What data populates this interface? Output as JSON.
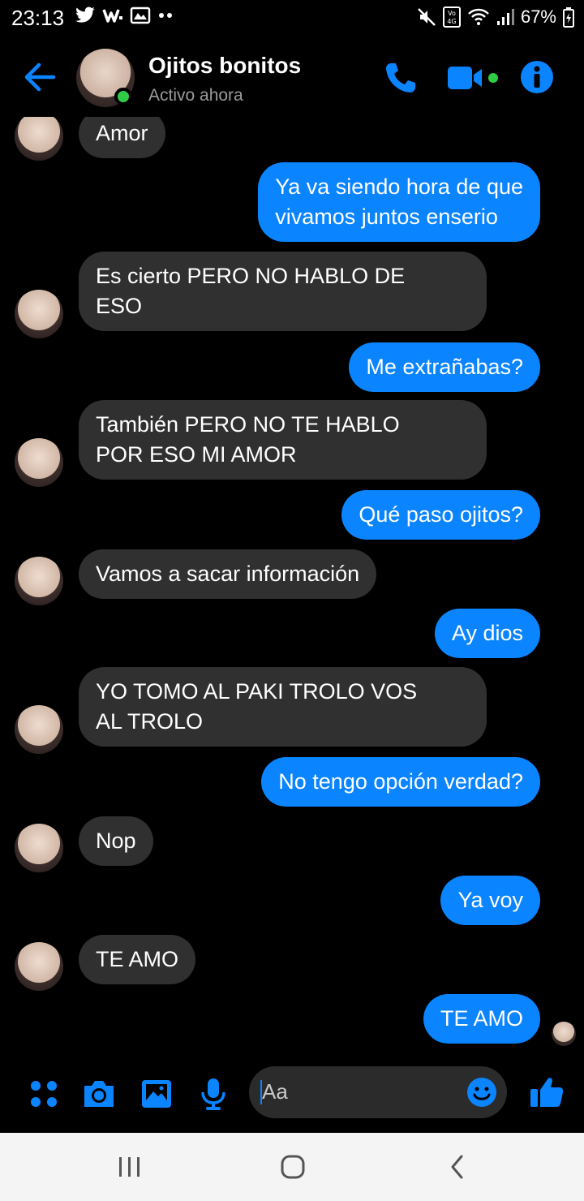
{
  "status_bar": {
    "time": "23:13",
    "battery": "67%"
  },
  "header": {
    "contact_name": "Ojitos bonitos",
    "contact_status": "Activo ahora"
  },
  "messages": [
    {
      "side": "in",
      "text": "Amor"
    },
    {
      "side": "out",
      "text": "Ya va siendo hora de que\nvivamos juntos enserio"
    },
    {
      "side": "in",
      "text": "Es cierto PERO NO HABLO DE\nESO"
    },
    {
      "side": "out",
      "text": "Me extrañabas?"
    },
    {
      "side": "in",
      "text": "También PERO NO TE HABLO\nPOR ESO MI AMOR"
    },
    {
      "side": "out",
      "text": "Qué paso ojitos?"
    },
    {
      "side": "in",
      "text": "Vamos a sacar información"
    },
    {
      "side": "out",
      "text": "Ay dios"
    },
    {
      "side": "in",
      "text": "YO TOMO AL PAKI TROLO VOS\nAL TROLO"
    },
    {
      "side": "out",
      "text": "No tengo opción verdad?"
    },
    {
      "side": "in",
      "text": "Nop"
    },
    {
      "side": "out",
      "text": "Ya voy"
    },
    {
      "side": "in",
      "text": "TE AMO"
    },
    {
      "side": "out",
      "text": "TE AMO"
    }
  ],
  "composer": {
    "placeholder": "Aa"
  },
  "colors": {
    "accent": "#0a84ff",
    "incoming_bubble": "#303030",
    "online": "#31cc46"
  },
  "icons": [
    "back-arrow-icon",
    "phone-icon",
    "video-camera-icon",
    "info-icon",
    "apps-grid-icon",
    "camera-icon",
    "gallery-icon",
    "microphone-icon",
    "emoji-icon",
    "thumbs-up-icon"
  ]
}
